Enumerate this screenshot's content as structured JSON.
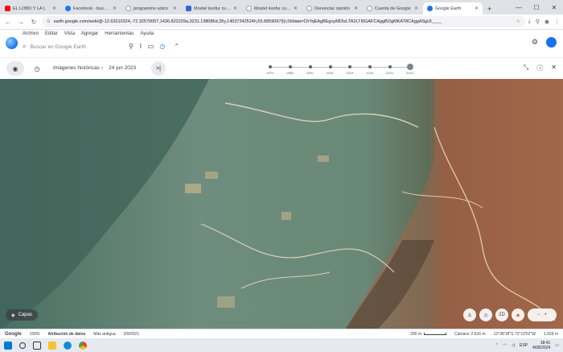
{
  "browser": {
    "tabs": [
      {
        "label": "EL LOBO Y LA L",
        "color": "#ff0000"
      },
      {
        "label": "Facebook - busca su",
        "color": "#1877f2"
      },
      {
        "label": "programmo antco",
        "color": "#5f6368"
      },
      {
        "label": "Mostel kunfur cuscu",
        "color": "#3367d6"
      },
      {
        "label": "Mostel kunfur cuscu",
        "color": "#5f6368"
      },
      {
        "label": "Denunciar opinión",
        "color": "#5f6368"
      },
      {
        "label": "Cuenta de Google",
        "color": "#5f6368"
      },
      {
        "label": "Google Earth",
        "color": "#1a73e8",
        "active": true
      }
    ],
    "url": "earth.google.com/web/@-12.63210324,-72.32579007,1436.822229a,3231.138086d,35y,14537242524h,55.8959067(l)r,0t/data=ChYqEAgBEgoyMDIzLTA2LTI0GAFCAggBOgMKAT8CAggASgUI____"
  },
  "earth": {
    "menu": [
      "Archivo",
      "Editar",
      "Vista",
      "Agregar",
      "Herramientas",
      "Ayuda"
    ],
    "search_placeholder": "Buscar en Google Earth",
    "history": {
      "title": "Imágenes históricas",
      "date": "24 jun 2023",
      "years": [
        "1970",
        "1985",
        "2000",
        "2015",
        "2019",
        "2020",
        "2021",
        "2023"
      ]
    },
    "layers_label": "Capas",
    "zoom_label": "2D"
  },
  "status": {
    "logo": "Google",
    "zoom": "100%",
    "attribution": "Atribución de datos",
    "oldest": "Más antigua",
    "oldest_date": "3/9/2021",
    "scale": "200 m",
    "camera": "Cámara: 2.616 m",
    "coords": "12°38'18\"S 72°19'52\"W",
    "elevation": "1.629 m"
  },
  "taskbar": {
    "lang": "ESP",
    "time": "18:41",
    "date": "4/08/2024"
  }
}
